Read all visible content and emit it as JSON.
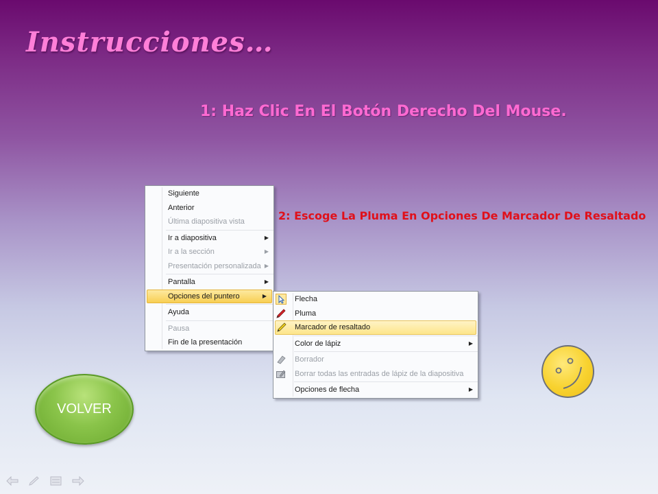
{
  "title": "Instrucciones…",
  "step1": "1: Haz Clic En El Botón Derecho Del Mouse.",
  "step2": "2: Escoge La Pluma En Opciones De Marcador  De Resaltado",
  "menu1": {
    "items": [
      {
        "label": "Siguiente",
        "disabled": false
      },
      {
        "label": "Anterior",
        "disabled": false
      },
      {
        "label": "Última diapositiva vista",
        "disabled": true
      },
      {
        "label": "Ir a diapositiva",
        "disabled": false,
        "submenu": true
      },
      {
        "label": "Ir a la sección",
        "disabled": true,
        "submenu": true
      },
      {
        "label": "Presentación personalizada",
        "disabled": true,
        "submenu": true
      },
      {
        "label": "Pantalla",
        "disabled": false,
        "submenu": true
      },
      {
        "label": "Opciones del puntero",
        "disabled": false,
        "submenu": true,
        "active": true
      },
      {
        "label": "Ayuda",
        "disabled": false
      },
      {
        "label": "Pausa",
        "disabled": true
      },
      {
        "label": "Fin de la presentación",
        "disabled": false
      }
    ]
  },
  "menu2": {
    "items": [
      {
        "label": "Flecha",
        "icon": "arrow-cursor-icon"
      },
      {
        "label": "Pluma",
        "icon": "pen-icon"
      },
      {
        "label": "Marcador de resaltado",
        "icon": "highlighter-icon",
        "highlighted": true
      },
      {
        "label": "Color de lápiz",
        "submenu": true
      },
      {
        "label": "Borrador",
        "icon": "eraser-icon",
        "disabled": true
      },
      {
        "label": "Borrar todas las entradas de lápiz de la diapositiva",
        "icon": "erase-all-icon",
        "disabled": true
      },
      {
        "label": "Opciones de flecha",
        "submenu": true
      }
    ]
  },
  "volver_label": "VOLVER",
  "colors": {
    "title": "#ff7fd8",
    "step1": "#ff6ad2",
    "step2": "#e0101a",
    "volver_button": "#8ac44a",
    "smiley": "#f8d22f"
  }
}
